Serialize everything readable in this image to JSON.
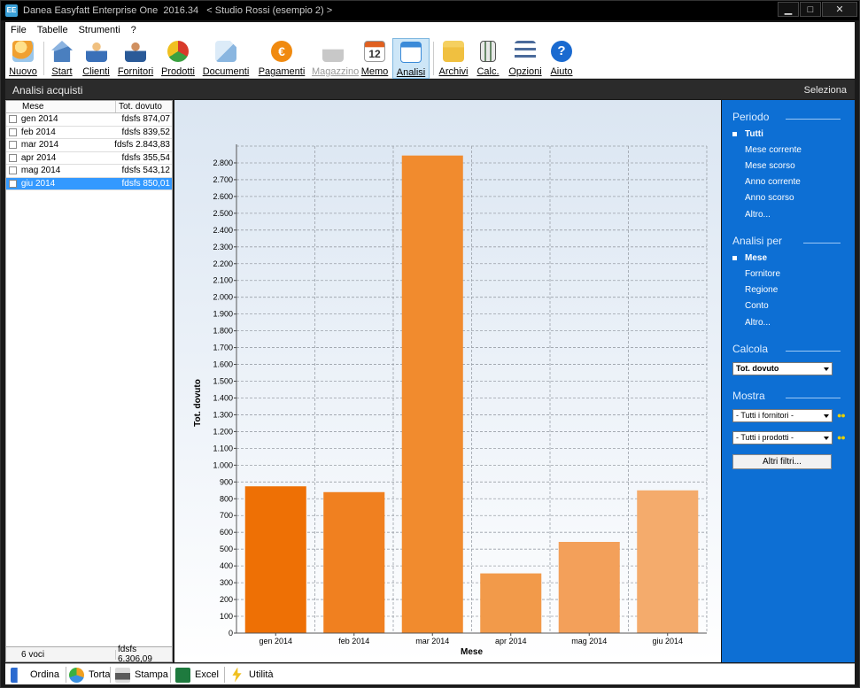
{
  "window": {
    "icon_text": "EE",
    "title": "Danea Easyfatt Enterprise One  2016.34   < Studio Rossi (esempio 2) >",
    "minimize_label": "▁",
    "maximize_label": "□",
    "close_label": "✕"
  },
  "menu": [
    "File",
    "Tabelle",
    "Strumenti",
    "?"
  ],
  "toolbar": {
    "buttons": [
      {
        "label": "Nuovo",
        "icon": "new-icon",
        "color": "#f0a030"
      },
      {
        "label": "Start",
        "icon": "home-icon",
        "color": "#4a7fbf"
      },
      {
        "label": "Clienti",
        "icon": "client-icon",
        "color": "#e0a040"
      },
      {
        "label": "Fornitori",
        "icon": "supplier-icon",
        "color": "#3a70b8"
      },
      {
        "label": "Prodotti",
        "icon": "products-icon",
        "color": "#d83a2a"
      },
      {
        "label": "Documenti",
        "icon": "documents-icon",
        "color": "#8ab6e0"
      },
      {
        "label": "Pagamenti",
        "icon": "payments-icon",
        "color": "#f08a10"
      },
      {
        "label": "Magazzino",
        "icon": "warehouse-icon",
        "color": "#b8b8b8"
      },
      {
        "label": "Memo",
        "icon": "calendar-icon",
        "color": "#e06020"
      },
      {
        "label": "Analisi",
        "icon": "analysis-icon",
        "color": "#3a8ad8"
      },
      {
        "label": "Archivi",
        "icon": "archive-icon",
        "color": "#f0c040"
      },
      {
        "label": "Calc.",
        "icon": "calculator-icon",
        "color": "#6a8a6a"
      },
      {
        "label": "Opzioni",
        "icon": "options-icon",
        "color": "#4a6a9a"
      },
      {
        "label": "Aiuto",
        "icon": "help-icon",
        "color": "#1a6ad0"
      }
    ],
    "calendar_day": "12",
    "help_glyph": "?",
    "payments_glyph": "€"
  },
  "section": {
    "title": "Analisi acquisti",
    "action": "Seleziona"
  },
  "list": {
    "col_month": "Mese",
    "col_total": "Tot. dovuto",
    "rows": [
      {
        "month": "gen 2014",
        "total": "fdsfs 874,07"
      },
      {
        "month": "feb 2014",
        "total": "fdsfs 839,52"
      },
      {
        "month": "mar 2014",
        "total": "fdsfs 2.843,83"
      },
      {
        "month": "apr 2014",
        "total": "fdsfs 355,54"
      },
      {
        "month": "mag 2014",
        "total": "fdsfs 543,12"
      },
      {
        "month": "giu 2014",
        "total": "fdsfs 850,01"
      }
    ],
    "selected_index": 5,
    "footer_count": "6 voci",
    "footer_total": "fdsfs 6.306,09"
  },
  "chart_data": {
    "type": "bar",
    "categories": [
      "gen 2014",
      "feb 2014",
      "mar 2014",
      "apr 2014",
      "mag 2014",
      "giu 2014"
    ],
    "values": [
      874.07,
      839.52,
      2843.83,
      355.54,
      543.12,
      850.01
    ],
    "colors": [
      "#ee7005",
      "#f08020",
      "#f18b2e",
      "#f29a4a",
      "#f3a05a",
      "#f4ab6c"
    ],
    "xlabel": "Mese",
    "ylabel": "Tot. dovuto",
    "ylim": [
      0,
      2900
    ],
    "ytick_step": 100,
    "ytick_labels": [
      "0",
      "100",
      "200",
      "300",
      "400",
      "500",
      "600",
      "700",
      "800",
      "900",
      "1.000",
      "1.100",
      "1.200",
      "1.300",
      "1.400",
      "1.500",
      "1.600",
      "1.700",
      "1.800",
      "1.900",
      "2.000",
      "2.100",
      "2.200",
      "2.300",
      "2.400",
      "2.500",
      "2.600",
      "2.700",
      "2.800"
    ],
    "grid": true
  },
  "right_panel": {
    "periodo_heading": "Periodo",
    "periodo_items": [
      "Tutti",
      "Mese corrente",
      "Mese scorso",
      "Anno corrente",
      "Anno scorso",
      "Altro..."
    ],
    "periodo_selected": 0,
    "analisi_heading": "Analisi per",
    "analisi_items": [
      "Mese",
      "Fornitore",
      "Regione",
      "Conto",
      "Altro..."
    ],
    "analisi_selected": 0,
    "calcola_heading": "Calcola",
    "calcola_value": "Tot. dovuto",
    "mostra_heading": "Mostra",
    "fornitori_value": "- Tutti i fornitori  -",
    "prodotti_value": "- Tutti i prodotti  -",
    "dots": "●●",
    "filter_button": "Altri filtri..."
  },
  "bottom_bar": {
    "buttons": [
      {
        "label": "Ordina",
        "icon": "sort-icon",
        "color": "#2a6ad0"
      },
      {
        "label": "Torta",
        "icon": "pie-chart-icon",
        "color": "#3a90e0"
      },
      {
        "label": "Stampa",
        "icon": "print-icon",
        "color": "#5a5a5a"
      },
      {
        "label": "Excel",
        "icon": "excel-icon",
        "color": "#1e7a3e"
      },
      {
        "label": "Utilità",
        "icon": "utility-icon",
        "color": "#f0c020"
      }
    ]
  }
}
